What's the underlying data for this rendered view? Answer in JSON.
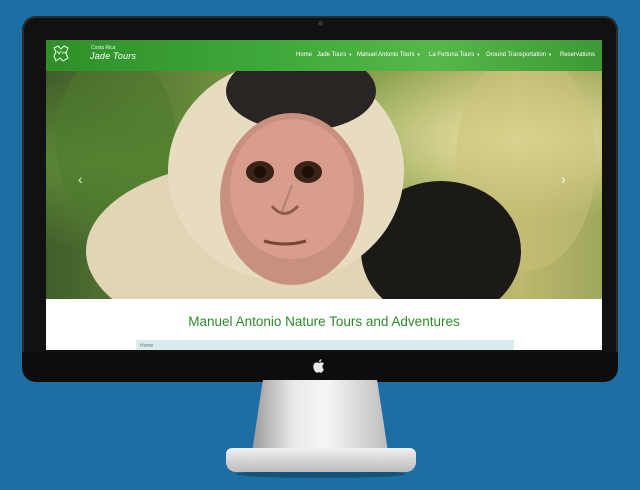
{
  "site": {
    "logo_top": "Costa Rica",
    "logo_name": "Jade Tours"
  },
  "nav": {
    "items": [
      {
        "label": "Home",
        "dropdown": false
      },
      {
        "label": "Jade Tours",
        "dropdown": true
      },
      {
        "label": "Manuel Antonio Tours",
        "dropdown": true
      },
      {
        "label": "La Fortuna Tours",
        "dropdown": true
      },
      {
        "label": "Ground Transportation",
        "dropdown": true
      },
      {
        "label": "Reservations",
        "dropdown": false
      }
    ],
    "caret": "▼"
  },
  "hero": {
    "prev_arrow": "‹",
    "next_arrow": "›"
  },
  "main": {
    "title": "Manuel Antonio Nature Tours and Adventures",
    "breadcrumb": "Home"
  },
  "colors": {
    "background": "#1d6fa3",
    "nav_green": "#3fa83a",
    "title_green": "#2d8a2a"
  }
}
